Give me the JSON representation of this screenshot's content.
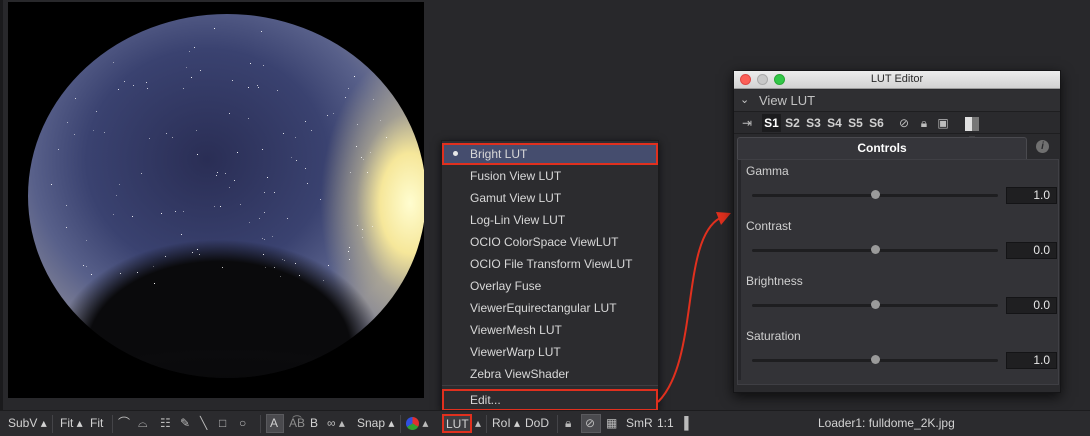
{
  "viewer": {
    "image_alt": "fulldome night sky"
  },
  "lut_menu": {
    "items": [
      {
        "label": "Bright LUT",
        "selected": true
      },
      {
        "label": "Fusion View LUT",
        "selected": false
      },
      {
        "label": "Gamut View LUT",
        "selected": false
      },
      {
        "label": "Log-Lin View LUT",
        "selected": false
      },
      {
        "label": "OCIO ColorSpace ViewLUT",
        "selected": false
      },
      {
        "label": "OCIO File Transform ViewLUT",
        "selected": false
      },
      {
        "label": "Overlay Fuse",
        "selected": false
      },
      {
        "label": "ViewerEquirectangular LUT",
        "selected": false
      },
      {
        "label": "ViewerMesh LUT",
        "selected": false
      },
      {
        "label": "ViewerWarp LUT",
        "selected": false
      },
      {
        "label": "Zebra ViewShader",
        "selected": false
      }
    ],
    "edit_label": "Edit...",
    "highlight_color": "#e0301e"
  },
  "lut_editor": {
    "title": "LUT Editor",
    "section_title": "View LUT",
    "slots": [
      "S1",
      "S2",
      "S3",
      "S4",
      "S5",
      "S6"
    ],
    "active_slot": "S1",
    "tab_label": "Controls",
    "params": [
      {
        "label": "Gamma",
        "value": "1.0",
        "level": 0.5
      },
      {
        "label": "Contrast",
        "value": "0.0",
        "level": 0.5
      },
      {
        "label": "Brightness",
        "value": "0.0",
        "level": 0.5
      },
      {
        "label": "Saturation",
        "value": "1.0",
        "level": 0.5
      }
    ]
  },
  "toolbar": {
    "subv": "SubV",
    "fit1": "Fit",
    "fit2": "Fit",
    "a": "A",
    "ab": "A͡B",
    "b": "B",
    "snap": "Snap",
    "lut": "LUT",
    "roi": "RoI",
    "dod": "DoD",
    "smr": "SmR",
    "ratio": "1:1",
    "loader_label": "Loader1: fulldome_2K.jpg"
  }
}
